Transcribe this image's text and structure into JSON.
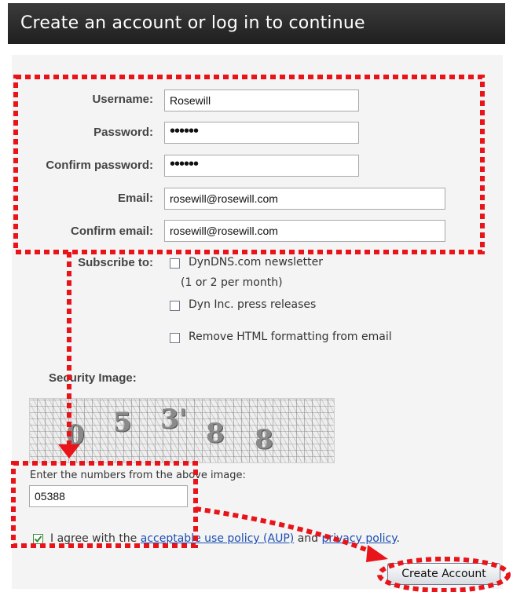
{
  "header": {
    "title": "Create an account or log in to continue"
  },
  "form": {
    "username_label": "Username:",
    "username_value": "Rosewill",
    "password_label": "Password:",
    "password_value": "••••••",
    "confirm_password_label": "Confirm password:",
    "confirm_password_value": "••••••",
    "email_label": "Email:",
    "email_value": "rosewill@rosewill.com",
    "confirm_email_label": "Confirm email:",
    "confirm_email_value": "rosewill@rosewill.com"
  },
  "subscribe": {
    "label": "Subscribe to:",
    "options": [
      {
        "label": "DynDNS.com newsletter",
        "note": "(1 or 2 per month)",
        "checked": false
      },
      {
        "label": "Dyn Inc. press releases",
        "checked": false
      },
      {
        "label": "Remove HTML formatting from email",
        "checked": false
      }
    ]
  },
  "security": {
    "label": "Security Image:",
    "digits": [
      "0",
      "5",
      "3'",
      "8",
      "8"
    ],
    "prompt": "Enter the numbers from the above image:",
    "input_value": "05388"
  },
  "agree": {
    "checked": true,
    "text_before": "I agree with the",
    "aup_link": "acceptable use policy (AUP)",
    "text_middle": "and",
    "privacy_link": "privacy policy",
    "text_after": "."
  },
  "buttons": {
    "create_account": "Create Account"
  },
  "colors": {
    "annotation_red": "#e8141a",
    "link_blue": "#1a4db3",
    "header_bg": "#2a2a2a"
  }
}
